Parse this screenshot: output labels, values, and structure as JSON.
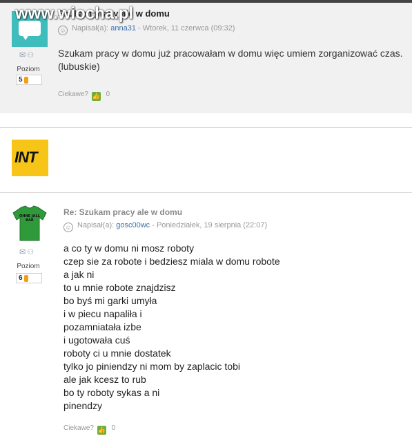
{
  "watermark": "www.wiocha.pl",
  "post1": {
    "title": "Szukam pracy ale w domu",
    "meta_prefix": "Napisał(a):",
    "author": "anna31",
    "date": "- Wtorek, 11 czerwca (09:32)",
    "level_label": "Poziom",
    "level": "5",
    "level_progress": 0.15,
    "body": "Szukam pracy w domu już pracowałam w domu więc umiem zorganizować czas. (lubuskie)",
    "ciekawe_label": "Ciekawe?",
    "ciekawe_count": "0"
  },
  "ad": {
    "logo_text": "INT"
  },
  "post2": {
    "title": "Re: Szukam pracy ale w domu",
    "meta_prefix": "Napisał(a):",
    "author": "gosc00wc",
    "date": "- Poniedziałek, 19 sierpnia (22:07)",
    "level_label": "Poziom",
    "level": "6",
    "level_progress": 0.2,
    "avatar_shirt_text": "OHNE JALL BAR",
    "lines": [
      "a co ty w domu ni mosz roboty",
      "czep sie za robote i bedziesz miala w domu robote",
      "a jak ni",
      "to u mnie robote znajdzisz",
      "bo byś mi garki umyła",
      "i w piecu napaliła i",
      "pozamniatała izbe",
      "i ugotowała cuś",
      "roboty ci u mnie dostatek",
      "tylko jo piniendzy ni mom by zaplacic tobi",
      "ale jak kcesz to rub",
      "bo ty roboty sykas a ni",
      "pinendzy"
    ],
    "ciekawe_label": "Ciekawe?",
    "ciekawe_count": "0"
  },
  "colors": {
    "avatar1": "#3fbcbc",
    "shirt": "#2f9a3a",
    "level_bar": "#f0a018",
    "int_logo_bg": "#f6c518",
    "link": "#3a6fa8"
  }
}
